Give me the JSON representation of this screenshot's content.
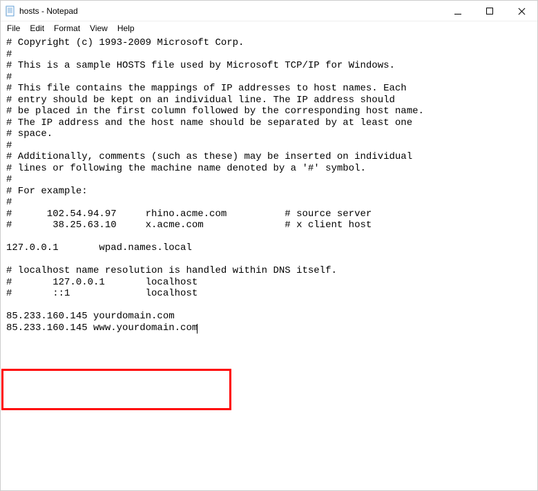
{
  "window": {
    "title": "hosts - Notepad"
  },
  "menu": {
    "file": "File",
    "edit": "Edit",
    "format": "Format",
    "view": "View",
    "help": "Help"
  },
  "content": {
    "text": "# Copyright (c) 1993-2009 Microsoft Corp.\n#\n# This is a sample HOSTS file used by Microsoft TCP/IP for Windows.\n#\n# This file contains the mappings of IP addresses to host names. Each\n# entry should be kept on an individual line. The IP address should\n# be placed in the first column followed by the corresponding host name.\n# The IP address and the host name should be separated by at least one\n# space.\n#\n# Additionally, comments (such as these) may be inserted on individual\n# lines or following the machine name denoted by a '#' symbol.\n#\n# For example:\n#\n#      102.54.94.97     rhino.acme.com          # source server\n#       38.25.63.10     x.acme.com              # x client host\n\n127.0.0.1       wpad.names.local\n\n# localhost name resolution is handled within DNS itself.\n#       127.0.0.1       localhost\n#       ::1             localhost\n\n85.233.160.145 yourdomain.com\n85.233.160.145 www.yourdomain.com"
  }
}
